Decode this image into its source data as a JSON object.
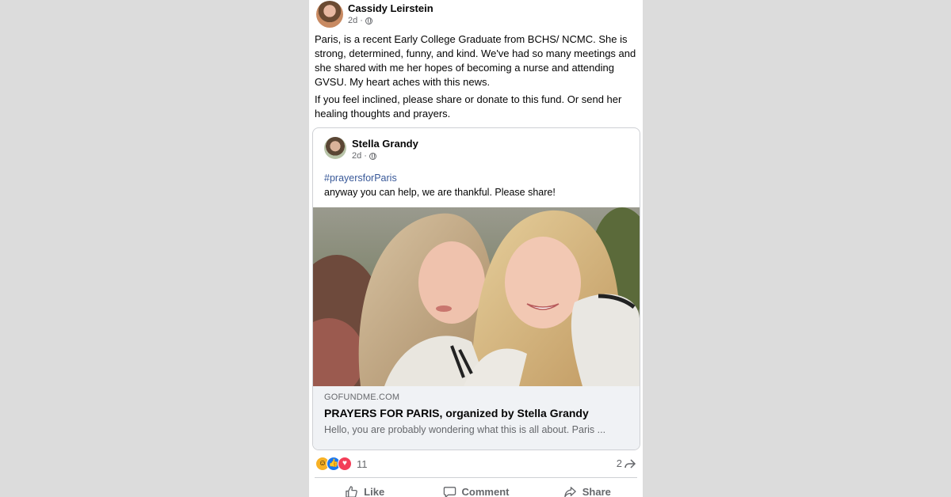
{
  "post": {
    "author": "Cassidy Leirstein",
    "time": "2d",
    "paragraphs": [
      "Paris, is a recent Early College Graduate from BCHS/ NCMC. She is strong, determined, funny, and kind. We've had so many meetings and she shared with me her hopes of becoming a nurse and attending GVSU. My heart aches with this news.",
      "If you feel inclined, please share or donate to this fund. Or send her healing thoughts and prayers."
    ]
  },
  "shared": {
    "author": "Stella Grandy",
    "time": "2d",
    "hashtag": "#prayersforParis",
    "text": "anyway you can help, we are thankful. Please share!",
    "link": {
      "domain": "GOFUNDME.COM",
      "title": "PRAYERS FOR PARIS, organized by Stella Grandy",
      "description": "Hello, you are probably wondering what this is all about. Paris ..."
    }
  },
  "reactions": {
    "types": [
      "care",
      "like",
      "love"
    ],
    "count": "11",
    "shares": "2"
  },
  "actions": {
    "like": "Like",
    "comment": "Comment",
    "share": "Share"
  },
  "colors": {
    "background": "#dcdcdc",
    "link": "#385898",
    "like": "#1877f2",
    "love": "#f33e58",
    "care": "#f7b125"
  }
}
